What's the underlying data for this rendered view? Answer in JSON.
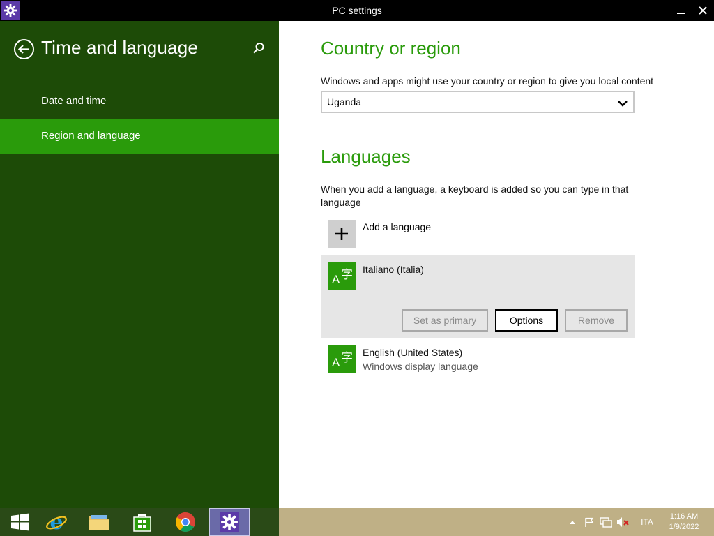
{
  "window": {
    "title": "PC settings",
    "icons": {
      "app": "gear-icon",
      "minimize": "minimize-icon",
      "close": "close-icon"
    }
  },
  "left": {
    "title": "Time and language",
    "back_icon": "back-arrow-icon",
    "search_icon": "search-icon",
    "items": [
      {
        "label": "Date and time",
        "selected": false
      },
      {
        "label": "Region and language",
        "selected": true
      }
    ]
  },
  "country": {
    "title": "Country or region",
    "description": "Windows and apps might use your country or region to give you local content",
    "selected": "Uganda"
  },
  "languages": {
    "title": "Languages",
    "description": "When you add a language, a keyboard is added so you can type in that language",
    "add_label": "Add a language",
    "items": [
      {
        "name": "Italiano (Italia)",
        "subtitle": "",
        "buttons": {
          "set_primary": "Set as primary",
          "options": "Options",
          "remove": "Remove"
        }
      },
      {
        "name": "English (United States)",
        "subtitle": "Windows display language"
      }
    ]
  },
  "taskbar": {
    "apps": [
      "windows-start-icon",
      "internet-explorer-icon",
      "file-explorer-icon",
      "store-icon",
      "chrome-icon",
      "pc-settings-icon"
    ],
    "tray": {
      "lang": "ITA",
      "time": "1:16 AM",
      "date": "1/9/2022"
    }
  },
  "colors": {
    "accent": "#2a9b0b",
    "left_bg": "#1d4b07",
    "titlebar": "#000000",
    "taskbar": "#bfb086"
  }
}
